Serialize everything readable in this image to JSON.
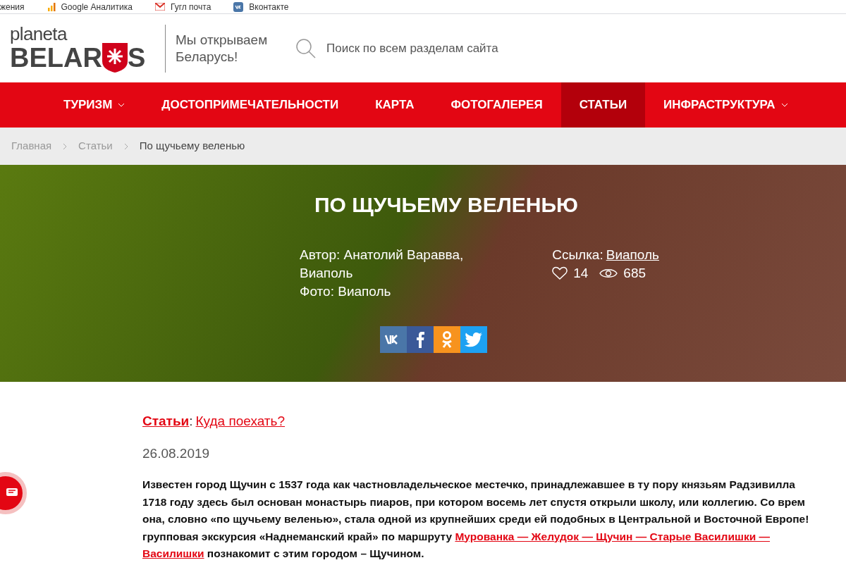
{
  "bookmarks": [
    {
      "label": "жения",
      "kind": "plain"
    },
    {
      "label": "Google Аналитика",
      "kind": "analytics"
    },
    {
      "label": "Гугл почта",
      "kind": "mail"
    },
    {
      "label": "Вконтакте",
      "kind": "vk"
    }
  ],
  "header": {
    "logo_top": "planeta",
    "logo_left": "BELAR",
    "logo_right": "S",
    "slogan": "Мы открываем Беларусь!",
    "search_placeholder": "Поиск по всем разделам сайта"
  },
  "nav": [
    {
      "label": "ТУРИЗМ",
      "dropdown": true,
      "selected": false
    },
    {
      "label": "ДОСТОПРИМЕЧАТЕЛЬНОСТИ",
      "dropdown": false,
      "selected": false
    },
    {
      "label": "КАРТА",
      "dropdown": false,
      "selected": false
    },
    {
      "label": "ФОТОГАЛЕРЕЯ",
      "dropdown": false,
      "selected": false
    },
    {
      "label": "СТАТЬИ",
      "dropdown": false,
      "selected": true
    },
    {
      "label": "ИНФРАСТРУКТУРА",
      "dropdown": true,
      "selected": false
    }
  ],
  "breadcrumbs": [
    "Главная",
    "Статьи",
    "По щучьему веленью"
  ],
  "hero": {
    "title": "ПО ЩУЧЬЕМУ ВЕЛЕНЬЮ",
    "author_lines": [
      "Автор: Анатолий Варавва,",
      "Виаполь",
      "Фото: Виаполь"
    ],
    "source_label": "Ссылка:",
    "source_link": "Виаполь",
    "likes": "14",
    "views": "685",
    "share": [
      {
        "kind": "vk",
        "color": "#4a76a8"
      },
      {
        "kind": "facebook",
        "color": "#3b5998"
      },
      {
        "kind": "ok",
        "color": "#f7931e"
      },
      {
        "kind": "twitter",
        "color": "#1da1f2"
      }
    ]
  },
  "article": {
    "category": "Статьи",
    "separator": ":",
    "subcategory": "Куда поехать?",
    "date": "26.08.2019",
    "lines": [
      [
        {
          "kind": "text",
          "text": "Известен город Щучин с 1537 года как частновладельческое местечко, принадлежавшее в ту пору князьям Радзивилла"
        }
      ],
      [
        {
          "kind": "text",
          "text": "1718 году здесь был основан монастырь пиаров, при котором восемь лет спустя открыли школу, или коллегию. Со врем"
        }
      ],
      [
        {
          "kind": "text",
          "text": "она, словно «по щучьему веленью», стала одной из крупнейших среди ей подобных в Центральной и Восточной Европе!"
        }
      ],
      [
        {
          "kind": "text",
          "text": "групповая экскурсия «Наднеманский край» по маршруту "
        },
        {
          "kind": "link",
          "text": "Мурованка — Желудок — Щучин — Старые Василишки —"
        }
      ],
      [
        {
          "kind": "link",
          "text": "Василишки"
        },
        {
          "kind": "text",
          "text": " познакомит с этим городом – Щучином."
        }
      ]
    ]
  }
}
